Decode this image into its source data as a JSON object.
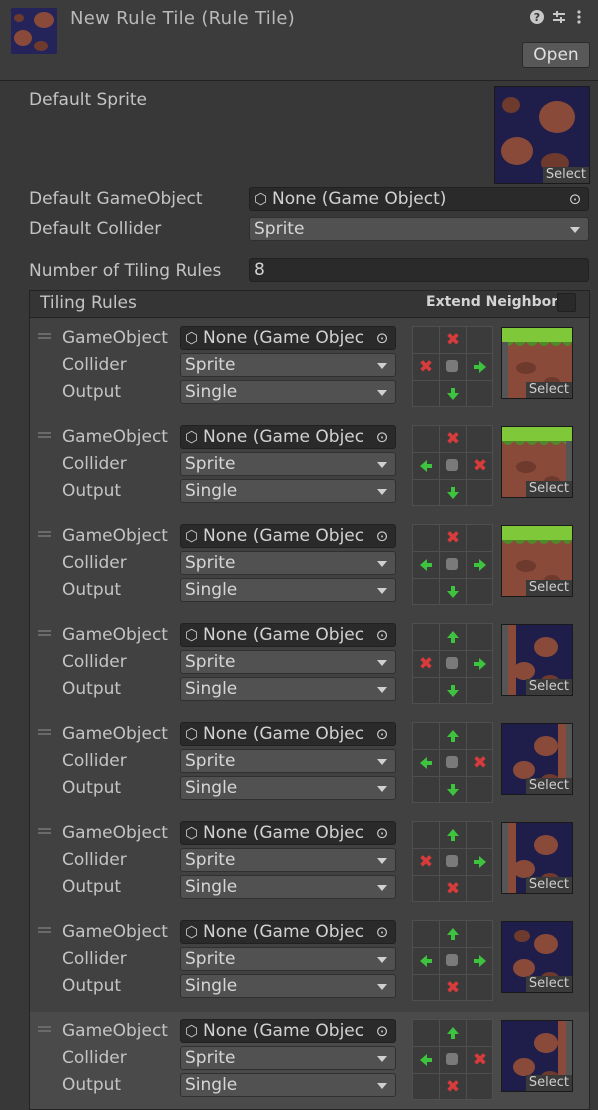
{
  "window": {
    "title": "New Rule Tile (Rule Tile)",
    "icons": [
      "help-icon",
      "settings-sliders-icon",
      "kebab-menu-icon"
    ],
    "open_label": "Open"
  },
  "default_sprite": {
    "label": "Default Sprite",
    "select_label": "Select"
  },
  "default_gameobject": {
    "label": "Default GameObject",
    "value": "None (Game Object)"
  },
  "default_collider": {
    "label": "Default Collider",
    "value": "Sprite"
  },
  "number_of_rules": {
    "label": "Number of Tiling Rules",
    "value": "8"
  },
  "tiling_rules": {
    "header": "Tiling Rules",
    "extend_neighbor_label": "Extend Neighbor",
    "rule_labels": {
      "gameobject": "GameObject",
      "collider": "Collider",
      "output": "Output"
    },
    "rules": [
      {
        "gameobject": "None (Game Objec",
        "collider": "Sprite",
        "output": "Single",
        "up": "x",
        "left": "x",
        "right": "arrow-right",
        "down": "arrow-down",
        "sprite": "grass-top-left",
        "select_label": "Select"
      },
      {
        "gameobject": "None (Game Objec",
        "collider": "Sprite",
        "output": "Single",
        "up": "x",
        "left": "arrow-left",
        "right": "x",
        "down": "arrow-down",
        "sprite": "grass-top-right",
        "select_label": "Select"
      },
      {
        "gameobject": "None (Game Objec",
        "collider": "Sprite",
        "output": "Single",
        "up": "x",
        "left": "arrow-left",
        "right": "arrow-right",
        "down": "arrow-down",
        "sprite": "grass-top-middle",
        "select_label": "Select"
      },
      {
        "gameobject": "None (Game Objec",
        "collider": "Sprite",
        "output": "Single",
        "up": "arrow-up",
        "left": "x",
        "right": "arrow-right",
        "down": "arrow-down",
        "sprite": "dirt-left-edge",
        "select_label": "Select"
      },
      {
        "gameobject": "None (Game Objec",
        "collider": "Sprite",
        "output": "Single",
        "up": "arrow-up",
        "left": "arrow-left",
        "right": "x",
        "down": "arrow-down",
        "sprite": "dirt-right-edge",
        "select_label": "Select"
      },
      {
        "gameobject": "None (Game Objec",
        "collider": "Sprite",
        "output": "Single",
        "up": "arrow-up",
        "left": "x",
        "right": "arrow-right",
        "down": "x",
        "sprite": "dirt-bottom-left",
        "select_label": "Select"
      },
      {
        "gameobject": "None (Game Objec",
        "collider": "Sprite",
        "output": "Single",
        "up": "arrow-up",
        "left": "arrow-left",
        "right": "arrow-right",
        "down": "x",
        "sprite": "dirt-bottom-middle",
        "select_label": "Select"
      },
      {
        "gameobject": "None (Game Objec",
        "collider": "Sprite",
        "output": "Single",
        "up": "arrow-up",
        "left": "arrow-left",
        "right": "x",
        "down": "x",
        "sprite": "dirt-bottom-right",
        "select_label": "Select"
      }
    ]
  },
  "colors": {
    "background": "#383838",
    "deny_x": "#d83b3b",
    "allow_arrow": "#3ec33e",
    "sprite_bg": "#1f1e4a",
    "rock": "#8a4a3a",
    "grass": "#7ec83a"
  }
}
